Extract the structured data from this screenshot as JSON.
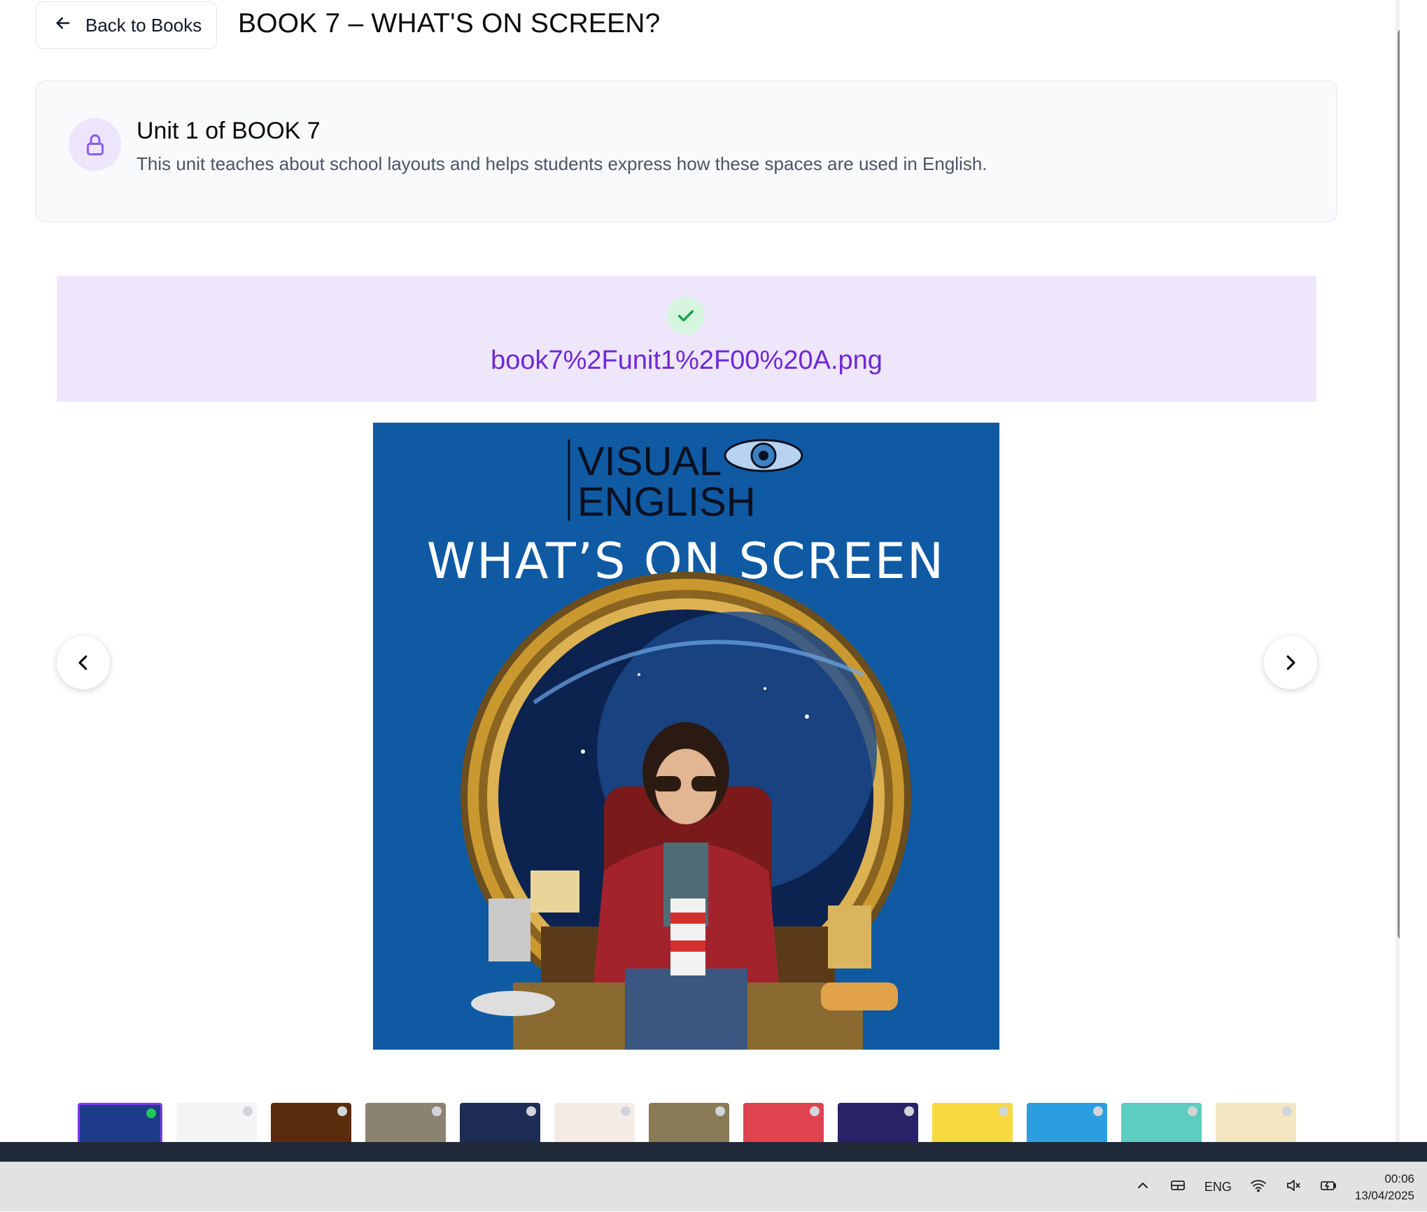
{
  "header": {
    "back_label": "Back to Books",
    "title": "BOOK 7 – WHAT'S ON SCREEN?"
  },
  "unit": {
    "title": "Unit 1 of BOOK 7",
    "description": "This unit teaches about school layouts and helps students express how these spaces are used in English."
  },
  "viewer": {
    "file_name": "book7%2Funit1%2F00%20A.png",
    "image": {
      "logo_line1": "VISUAL",
      "logo_line2": "ENGLISH",
      "heading": "WHAT’S ON SCREEN"
    }
  },
  "thumbnails": [
    {
      "id": 1,
      "active": true,
      "done": true,
      "bg": "#1e3a8a"
    },
    {
      "id": 2,
      "active": false,
      "done": false,
      "bg": "#f3f4f6"
    },
    {
      "id": 3,
      "active": false,
      "done": false,
      "bg": "#5a2c0d"
    },
    {
      "id": 4,
      "active": false,
      "done": false,
      "bg": "#8b8372"
    },
    {
      "id": 5,
      "active": false,
      "done": false,
      "bg": "#1e2d55"
    },
    {
      "id": 6,
      "active": false,
      "done": false,
      "bg": "#f5ece6"
    },
    {
      "id": 7,
      "active": false,
      "done": false,
      "bg": "#8a7a55"
    },
    {
      "id": 8,
      "active": false,
      "done": false,
      "bg": "#e0434f"
    },
    {
      "id": 9,
      "active": false,
      "done": false,
      "bg": "#2a2266"
    },
    {
      "id": 10,
      "active": false,
      "done": false,
      "bg": "#f8d940"
    },
    {
      "id": 11,
      "active": false,
      "done": false,
      "bg": "#2a9ee0"
    },
    {
      "id": 12,
      "active": false,
      "done": false,
      "bg": "#5ccdbf"
    },
    {
      "id": 13,
      "active": false,
      "done": false,
      "bg": "#f3e7c3"
    }
  ],
  "taskbar": {
    "language": "ENG",
    "time": "00:06",
    "date": "13/04/2025"
  },
  "colors": {
    "accent": "#6d28d9",
    "banner_bg": "#eee6fb",
    "image_bg": "#0f5aa3",
    "success": "#16a34a"
  }
}
